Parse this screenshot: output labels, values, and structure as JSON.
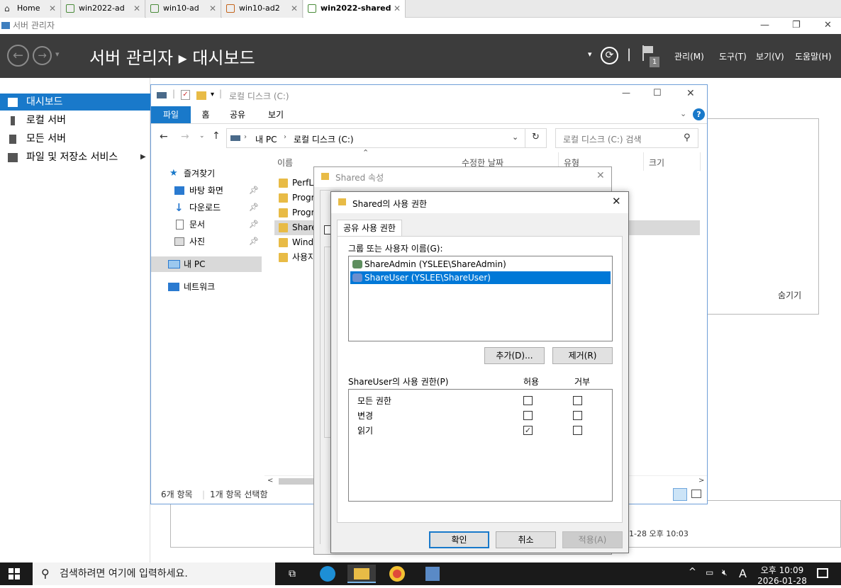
{
  "vm_tabs": [
    {
      "label": "Home"
    },
    {
      "label": "win2022-ad"
    },
    {
      "label": "win10-ad"
    },
    {
      "label": "win10-ad2"
    },
    {
      "label": "win2022-shared"
    }
  ],
  "server_manager": {
    "window_title": "서버 관리자",
    "header_title": "서버 관리자 ▸ 대시보드",
    "menus": [
      "관리(M)",
      "도구(T)",
      "보기(V)",
      "도움말(H)"
    ],
    "flag_badge": "1",
    "sidebar": [
      {
        "label": "대시보드",
        "selected": true
      },
      {
        "label": "로컬 서버"
      },
      {
        "label": "모든 서버"
      },
      {
        "label": "파일 및 저장소 서비스"
      }
    ],
    "hide_label": "숨기기",
    "timestamp_fragment": "1-28 오후 10:03"
  },
  "explorer": {
    "title": "로컬 디스크 (C:)",
    "ribbon_tabs": [
      "파일",
      "홈",
      "공유",
      "보기"
    ],
    "address": {
      "root": "내 PC",
      "current": "로컬 디스크 (C:)"
    },
    "search_placeholder": "로컬 디스크 (C:) 검색",
    "nav": [
      {
        "label": "즐겨찾기",
        "icon": "star-icon"
      },
      {
        "label": "바탕 화면",
        "icon": "desktop-icon",
        "pinned": true
      },
      {
        "label": "다운로드",
        "icon": "download-icon",
        "pinned": true
      },
      {
        "label": "문서",
        "icon": "document-icon",
        "pinned": true
      },
      {
        "label": "사진",
        "icon": "picture-icon",
        "pinned": true
      },
      {
        "label": "내 PC",
        "icon": "computer-icon",
        "selected": true
      },
      {
        "label": "네트워크",
        "icon": "network-icon"
      }
    ],
    "columns": [
      "이름",
      "수정한 날짜",
      "유형",
      "크기"
    ],
    "files": [
      "PerfLo",
      "Progra",
      "Progra",
      "Sharec",
      "Windo",
      "사용자"
    ],
    "status_count": "6개 항목",
    "status_selected": "1개 항목 선택함"
  },
  "properties_dialog": {
    "title": "Shared 속성"
  },
  "permission_dialog": {
    "title": "Shared의 사용 권한",
    "tab": "공유 사용 권한",
    "group_label": "그룹 또는 사용자 이름(G):",
    "users": [
      {
        "name": "ShareAdmin (YSLEE\\ShareAdmin)",
        "selected": false
      },
      {
        "name": "ShareUser (YSLEE\\ShareUser)",
        "selected": true
      }
    ],
    "add_button": "추가(D)...",
    "remove_button": "제거(R)",
    "perm_label": "ShareUser의 사용 권한(P)",
    "allow_header": "허용",
    "deny_header": "거부",
    "permissions": [
      {
        "name": "모든 권한",
        "allow": false,
        "deny": false
      },
      {
        "name": "변경",
        "allow": false,
        "deny": false
      },
      {
        "name": "읽기",
        "allow": true,
        "deny": false
      }
    ],
    "ok_button": "확인",
    "cancel_button": "취소",
    "apply_button": "적용(A)"
  },
  "taskbar": {
    "search_placeholder": "검색하려면 여기에 입력하세요.",
    "time": "오후 10:09",
    "date": "2026-01-28",
    "ime": "A"
  }
}
